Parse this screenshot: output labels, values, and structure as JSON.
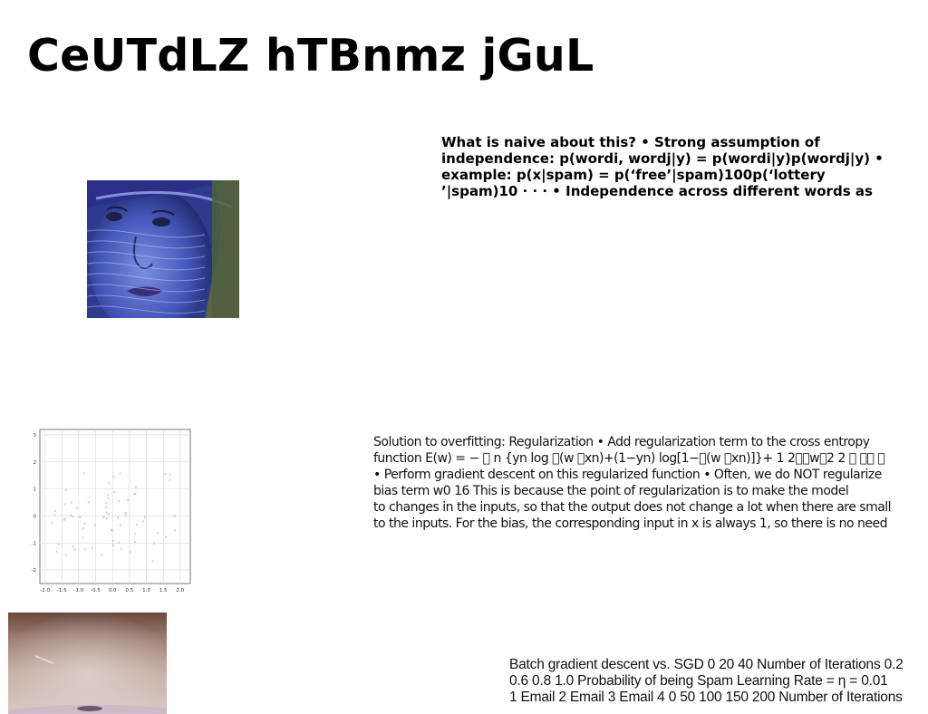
{
  "title": "CeUTdLZ hTBnmz jGuL",
  "naive_text": {
    "lines": [
      "What is naive about this? • Strong assumption of",
      "independence: p(wordi, wordj|y) = p(wordi|y)p(wordj|y) •",
      "example: p(x|spam) = p(‘free’|spam)100p(‘lottery",
      "’|spam)10 · · · • Independence across different words as"
    ]
  },
  "regularization_text": {
    "lines": [
      "Solution to overfitting: Regularization • Add regularization term to the cross entropy",
      "function E(w) = − ￿ n {yn log ￿(w ￿xn)+(1−yn) log[1−￿(w ￿xn)]}+ 1 2￿￿w￿2 2 ￿ ￿￿ ￿",
      "• Perform gradient descent on this regularized function • Often, we do NOT regularize",
      "bias term w0 16 This is because the point of regularization is to make the model",
      "to changes in the inputs, so that the output does not change a lot when there are small",
      "to the inputs. For the bias, the corresponding input in x is always 1, so there is no need"
    ]
  },
  "sgd_text": {
    "lines": [
      "Batch gradient descent vs. SGD 0 20 40 Number of Iterations 0.2",
      "0.6 0.8 1.0 Probability of being Spam Learning Rate = η = 0.01",
      "1 Email 2 Email 3 Email 4 0 50 100 150 200 Number of Iterations"
    ]
  },
  "scatter": {
    "x_ticks": [
      "-2.0",
      "-1.5",
      "-1.0",
      "-0.5",
      "0.0",
      "0.5",
      "1.0",
      "1.5",
      "2.0"
    ],
    "y_ticks": [
      "3",
      "2",
      "1",
      "0",
      "-1",
      "-2"
    ],
    "point_color": "#9fd3c0"
  },
  "colors": {
    "face_tint": "#3f52b0",
    "room_wall": "#b89a8e"
  }
}
